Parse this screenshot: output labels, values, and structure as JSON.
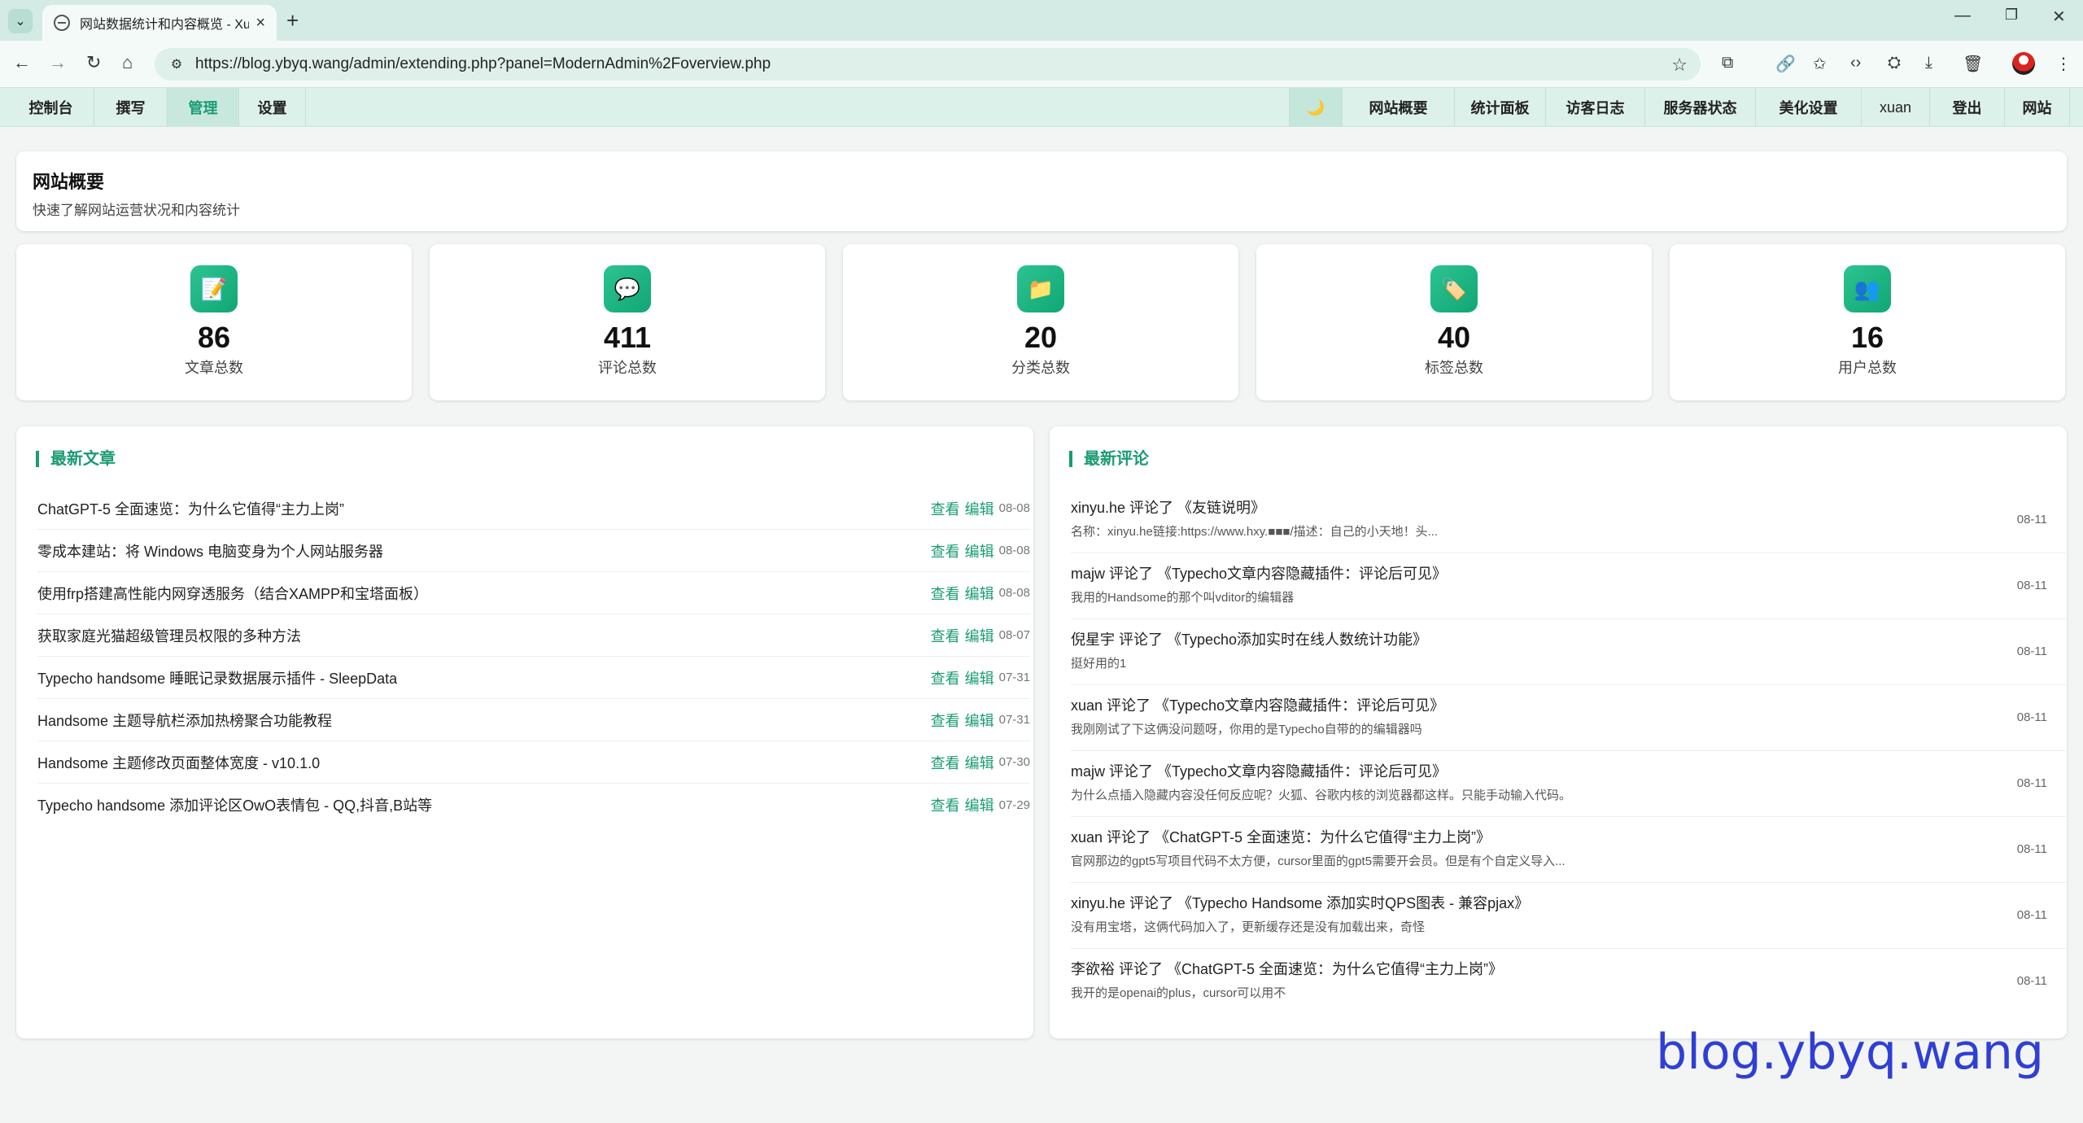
{
  "browser": {
    "tab_title": "网站数据统计和内容概览 - Xua",
    "url": "https://blog.ybyq.wang/admin/extending.php?panel=ModernAdmin%2Foverview.php"
  },
  "admin_nav": {
    "left": [
      "控制台",
      "撰写",
      "管理",
      "设置"
    ],
    "active": "管理",
    "moon": "🌙",
    "right": [
      "网站概要",
      "统计面板",
      "访客日志",
      "服务器状态",
      "美化设置",
      "xuan",
      "登出",
      "网站"
    ]
  },
  "header": {
    "title": "网站概要",
    "subtitle": "快速了解网站运营状况和内容统计"
  },
  "stats": [
    {
      "icon": "📝",
      "icon_name": "document-icon",
      "value": "86",
      "label": "文章总数"
    },
    {
      "icon": "💬",
      "icon_name": "comment-icon",
      "value": "411",
      "label": "评论总数"
    },
    {
      "icon": "📁",
      "icon_name": "folder-icon",
      "value": "20",
      "label": "分类总数"
    },
    {
      "icon": "🏷️",
      "icon_name": "tag-icon",
      "value": "40",
      "label": "标签总数"
    },
    {
      "icon": "👥",
      "icon_name": "users-icon",
      "value": "16",
      "label": "用户总数"
    }
  ],
  "posts": {
    "title": "最新文章",
    "view_label": "查看",
    "edit_label": "编辑",
    "items": [
      {
        "title": "ChatGPT-5 全面速览：为什么它值得“主力上岗”",
        "date": "08-08"
      },
      {
        "title": "零成本建站：将 Windows 电脑变身为个人网站服务器",
        "date": "08-08"
      },
      {
        "title": "使用frp搭建高性能内网穿透服务（结合XAMPP和宝塔面板）",
        "date": "08-08"
      },
      {
        "title": "获取家庭光猫超级管理员权限的多种方法",
        "date": "08-07"
      },
      {
        "title": "Typecho handsome 睡眠记录数据展示插件 - SleepData",
        "date": "07-31"
      },
      {
        "title": "Handsome 主题导航栏添加热榜聚合功能教程",
        "date": "07-31"
      },
      {
        "title": "Handsome 主题修改页面整体宽度 - v10.1.0",
        "date": "07-30"
      },
      {
        "title": "Typecho handsome 添加评论区OwO表情包 - QQ,抖音,B站等",
        "date": "07-29"
      }
    ]
  },
  "comments": {
    "title": "最新评论",
    "items": [
      {
        "title": "xinyu.he 评论了 《友链说明》",
        "body": "名称：xinyu.he链接:https://www.hxy.■■■/描述：自己的小天地！头...",
        "date": "08-11"
      },
      {
        "title": "majw 评论了 《Typecho文章内容隐藏插件：评论后可见》",
        "body": "我用的Handsome的那个叫vditor的编辑器",
        "date": "08-11"
      },
      {
        "title": "倪星宇 评论了 《Typecho添加实时在线人数统计功能》",
        "body": "挺好用的1",
        "date": "08-11"
      },
      {
        "title": "xuan 评论了 《Typecho文章内容隐藏插件：评论后可见》",
        "body": "我刚刚试了下这俩没问题呀，你用的是Typecho自带的的编辑器吗",
        "date": "08-11"
      },
      {
        "title": "majw 评论了 《Typecho文章内容隐藏插件：评论后可见》",
        "body": "为什么点插入隐藏内容没任何反应呢？火狐、谷歌内核的浏览器都这样。只能手动输入代码。",
        "date": "08-11"
      },
      {
        "title": "xuan 评论了 《ChatGPT-5 全面速览：为什么它值得“主力上岗”》",
        "body": "官网那边的gpt5写项目代码不太方便，cursor里面的gpt5需要开会员。但是有个自定义导入...",
        "date": "08-11"
      },
      {
        "title": "xinyu.he 评论了 《Typecho Handsome 添加实时QPS图表 - 兼容pjax》",
        "body": "没有用宝塔，这俩代码加入了，更新缓存还是没有加载出来，奇怪",
        "date": "08-11"
      },
      {
        "title": "李欲裕 评论了 《ChatGPT-5 全面速览：为什么它值得“主力上岗”》",
        "body": "我开的是openai的plus，cursor可以用不",
        "date": "08-11"
      }
    ]
  },
  "watermark": "blog.ybyq.wang"
}
